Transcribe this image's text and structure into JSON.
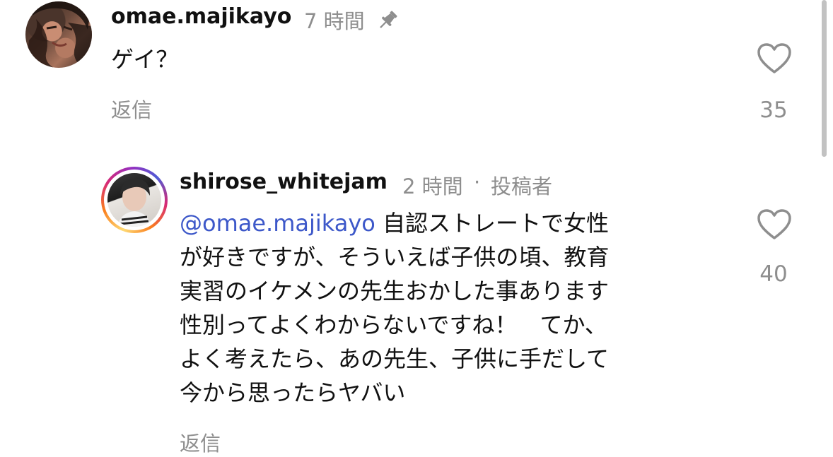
{
  "comment": {
    "username": "omae.majikayo",
    "time": "7 時間",
    "pin_icon": "pin-icon",
    "text": "ゲイ？",
    "reply_label": "返信",
    "like_count": "35",
    "like_icon": "heart-outline-icon"
  },
  "reply": {
    "username": "shirose_whitejam",
    "time": "2 時間",
    "separator": "·",
    "author_badge": "投稿者",
    "mention": "@omae.majikayo",
    "lines": [
      " 自認ストレートで女性",
      "が好きですが、そういえば子供の頃、教育",
      "実習のイケメンの先生おかした事あります",
      "性別ってよくわからないですね！　てか、",
      "よく考えたら、あの先生、子供に手だして",
      "今から思ったらヤバい"
    ],
    "reply_label": "返信",
    "like_count": "40",
    "like_icon": "heart-outline-icon"
  },
  "colors": {
    "mention": "#3d58c9",
    "meta_gray": "#8e8e8e",
    "text": "#111111"
  }
}
